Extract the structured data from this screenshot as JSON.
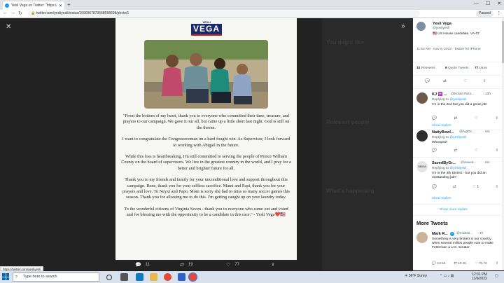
{
  "browser": {
    "tab_title": "Yesli Vega on Twitter: \"https://t...",
    "url": "twitter.com/yesliyesli/status/1590067873568558608/photo/1",
    "profile_label": "Paused",
    "status_link": "https://twitter.com/yesliyesli"
  },
  "ghost": {
    "whats_happening": "What's happening",
    "you_might_like": "You might like",
    "relevant_people": "Relevant people"
  },
  "card": {
    "logo_small": "YESLI",
    "logo_big": "VEGA",
    "paragraphs": [
      "\"From the bottom of my heart, thank you to everyone who committed their time, treasure, and prayers to our campaign. We gave it our all, but came up a little short last night. God is still on the throne.",
      "I want to congratulate the Congresswoman on a hard fought win. As Supervisor, I look forward to working with Abigail in the future.",
      "While this loss is heartbreaking, I'm still committed to serving the people of Prince William County on the board of supervisors. We live in the greatest country in the world, and I pray for a better and brighter future for all.",
      "Thank you to my friends and family for your unconditional love and support throughout this campaign. Rene, thank you for your selfless sacrifice. Mami and Papi, thank you for your prayers and love. To Neyxi and Papo, Mom is sorry she had to miss so many soccer games this season. Thank you for allowing me to do this. I'm getting caught up on your laundry today.",
      "To the wonderful citizens of Virginia Seven - thank you to everyone who came out and voted and for blessing me with the opportunity to be a candidate in this race.\" - Yesli Vega❤️🇺🇸"
    ]
  },
  "photo_actions": {
    "replies": "11",
    "retweets": "19",
    "likes": "77"
  },
  "sidebar": {
    "author_name": "Yesli Vega",
    "author_handle": "@yesliyesli",
    "author_bio": "🇺🇸 US House candidate, VA-07",
    "timestamp": "11:52 AM · Nov 9, 2022 · Twitter for iPhone",
    "stats": {
      "retweets_n": "10",
      "retweets_l": "Retweets",
      "quotes_n": "9",
      "quotes_l": "Quote Tweets",
      "likes_n": "77",
      "likes_l": "Likes"
    },
    "replies": [
      {
        "name": "KJ ✝️ ...",
        "handle": "@Kristin7563...",
        "time": "· 10h",
        "replying_to_prefix": "Replying to ",
        "replying_to": "@yesliyesli",
        "text": "I'm in the 2nd but you did a great job!",
        "likes": ""
      },
      {
        "name": "NattyBowl...",
        "handle": "@AgtOc...",
        "time": "· 6m",
        "replying_to_prefix": "Replying to ",
        "replying_to": "@yesliyesli",
        "text": "Whooped!",
        "likes": ""
      },
      {
        "name": "SavedByGr...",
        "handle": "@Saved...",
        "time": "· 6m",
        "replying_to_prefix": "Replying to ",
        "replying_to": "@yesliyesli",
        "text": "I'm in the 4th District - but you did an outstanding job?",
        "likes": "1",
        "avatar_text": "SBGA"
      }
    ],
    "show_replies": "Show replies",
    "show_more_replies": "Show more replies",
    "more_tweets_heading": "More Tweets",
    "more_tweet": {
      "name": "Mark R...",
      "handle": "@markle...",
      "time": "· 4h",
      "text": "Something is very broken in our country when several million people vote to make Fetterman a U.S. senator.",
      "replies": "13.5K",
      "retweets": "10.4K",
      "likes": "76.7K"
    }
  },
  "taskbar": {
    "search_placeholder": "Type here to search",
    "weather": "56°F Sunny",
    "time": "12:01 PM",
    "date": "11/9/2022"
  }
}
